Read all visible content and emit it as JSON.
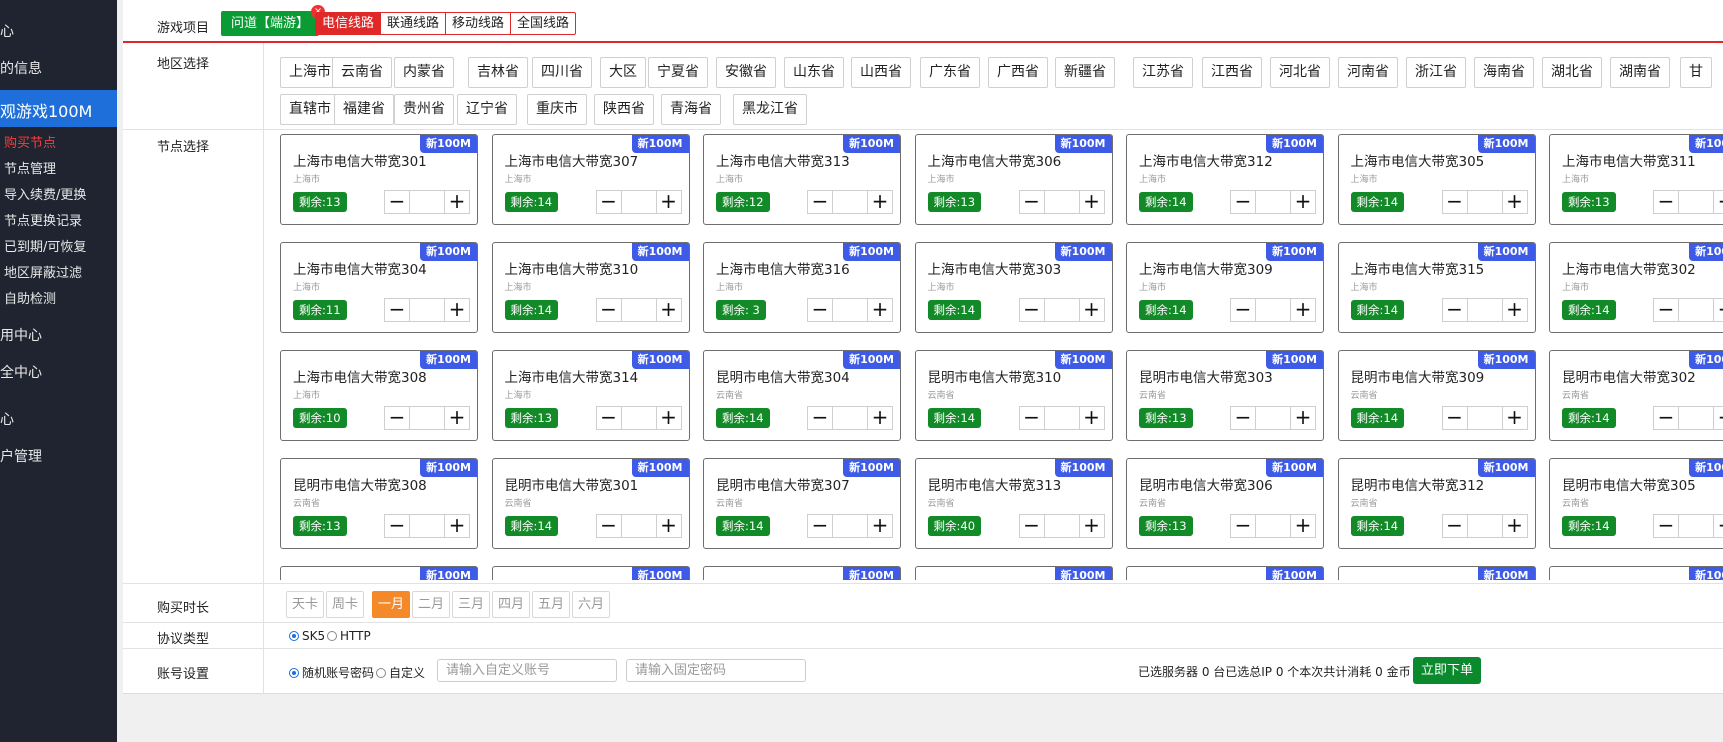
{
  "sidebar": {
    "items": [
      {
        "label": "心"
      },
      {
        "label": "的信息"
      },
      {
        "label": "观游戏100M"
      },
      {
        "label": "用中心"
      },
      {
        "label": "全中心"
      },
      {
        "label": "心"
      },
      {
        "label": "户管理"
      }
    ],
    "sub_items": [
      {
        "label": "购买节点",
        "active": true
      },
      {
        "label": "节点管理"
      },
      {
        "label": "导入续费/更换"
      },
      {
        "label": "节点更换记录"
      },
      {
        "label": "已到期/可恢复"
      },
      {
        "label": "地区屏蔽过滤"
      },
      {
        "label": "自助检测"
      }
    ]
  },
  "labels": {
    "game": "游戏项目",
    "region": "地区选择",
    "node": "节点选择",
    "duration": "购买时长",
    "protocol": "协议类型",
    "account": "账号设置"
  },
  "game_tag": {
    "label": "问道【端游】",
    "close": "×"
  },
  "lines": [
    "电信线路",
    "联通线路",
    "移动线路",
    "全国线路"
  ],
  "regions": [
    "上海市",
    "云南省",
    "内蒙省",
    "吉林省",
    "四川省",
    "大区",
    "宁夏省",
    "安徽省",
    "山东省",
    "山西省",
    "广东省",
    "广西省",
    "新疆省",
    "江苏省",
    "江西省",
    "河北省",
    "河南省",
    "浙江省",
    "海南省",
    "湖北省",
    "湖南省",
    "甘",
    "直辖市",
    "福建省",
    "贵州省",
    "辽宁省",
    "重庆市",
    "陕西省",
    "青海省",
    "黑龙江省"
  ],
  "nodes": [
    {
      "name": "上海市电信大带宽301",
      "loc": "上海市",
      "stock": "剩余:13"
    },
    {
      "name": "上海市电信大带宽307",
      "loc": "上海市",
      "stock": "剩余:14"
    },
    {
      "name": "上海市电信大带宽313",
      "loc": "上海市",
      "stock": "剩余:12"
    },
    {
      "name": "上海市电信大带宽306",
      "loc": "上海市",
      "stock": "剩余:13"
    },
    {
      "name": "上海市电信大带宽312",
      "loc": "上海市",
      "stock": "剩余:14"
    },
    {
      "name": "上海市电信大带宽305",
      "loc": "上海市",
      "stock": "剩余:14"
    },
    {
      "name": "上海市电信大带宽311",
      "loc": "上海市",
      "stock": "剩余:13"
    },
    {
      "name": "上海市电信大带宽304",
      "loc": "上海市",
      "stock": "剩余:11"
    },
    {
      "name": "上海市电信大带宽310",
      "loc": "上海市",
      "stock": "剩余:14"
    },
    {
      "name": "上海市电信大带宽316",
      "loc": "上海市",
      "stock": "剩余: 3"
    },
    {
      "name": "上海市电信大带宽303",
      "loc": "上海市",
      "stock": "剩余:14"
    },
    {
      "name": "上海市电信大带宽309",
      "loc": "上海市",
      "stock": "剩余:14"
    },
    {
      "name": "上海市电信大带宽315",
      "loc": "上海市",
      "stock": "剩余:14"
    },
    {
      "name": "上海市电信大带宽302",
      "loc": "上海市",
      "stock": "剩余:14"
    },
    {
      "name": "上海市电信大带宽308",
      "loc": "上海市",
      "stock": "剩余:10"
    },
    {
      "name": "上海市电信大带宽314",
      "loc": "上海市",
      "stock": "剩余:13"
    },
    {
      "name": "昆明市电信大带宽304",
      "loc": "云南省",
      "stock": "剩余:14"
    },
    {
      "name": "昆明市电信大带宽310",
      "loc": "云南省",
      "stock": "剩余:14"
    },
    {
      "name": "昆明市电信大带宽303",
      "loc": "云南省",
      "stock": "剩余:13"
    },
    {
      "name": "昆明市电信大带宽309",
      "loc": "云南省",
      "stock": "剩余:14"
    },
    {
      "name": "昆明市电信大带宽302",
      "loc": "云南省",
      "stock": "剩余:14"
    },
    {
      "name": "昆明市电信大带宽308",
      "loc": "云南省",
      "stock": "剩余:13"
    },
    {
      "name": "昆明市电信大带宽301",
      "loc": "云南省",
      "stock": "剩余:14"
    },
    {
      "name": "昆明市电信大带宽307",
      "loc": "云南省",
      "stock": "剩余:14"
    },
    {
      "name": "昆明市电信大带宽313",
      "loc": "云南省",
      "stock": "剩余:40"
    },
    {
      "name": "昆明市电信大带宽306",
      "loc": "云南省",
      "stock": "剩余:13"
    },
    {
      "name": "昆明市电信大带宽312",
      "loc": "云南省",
      "stock": "剩余:14"
    },
    {
      "name": "昆明市电信大带宽305",
      "loc": "云南省",
      "stock": "剩余:14"
    }
  ],
  "node_badge": "新100M",
  "durations": [
    {
      "label": "天卡"
    },
    {
      "label": "周卡"
    },
    {
      "label": "一月",
      "active": true
    },
    {
      "label": "二月"
    },
    {
      "label": "三月"
    },
    {
      "label": "四月"
    },
    {
      "label": "五月"
    },
    {
      "label": "六月"
    }
  ],
  "protocols": [
    {
      "label": "SK5",
      "checked": true
    },
    {
      "label": "HTTP",
      "checked": false
    }
  ],
  "account": {
    "random": "随机账号密码",
    "custom": "自定义",
    "account_placeholder": "请输入自定义账号",
    "password_placeholder": "请输入固定密码"
  },
  "summary": "已选服务器 0 台已选总IP 0 个本次共计消耗 0 金币",
  "order_button": "立即下单",
  "colors": {
    "accent_red": "#e02828",
    "green": "#138a28",
    "badge_blue": "#3d5be6",
    "active_orange": "#f5892a",
    "sidebar_bg": "#1f2430",
    "sidebar_active": "#1e6fd9"
  }
}
